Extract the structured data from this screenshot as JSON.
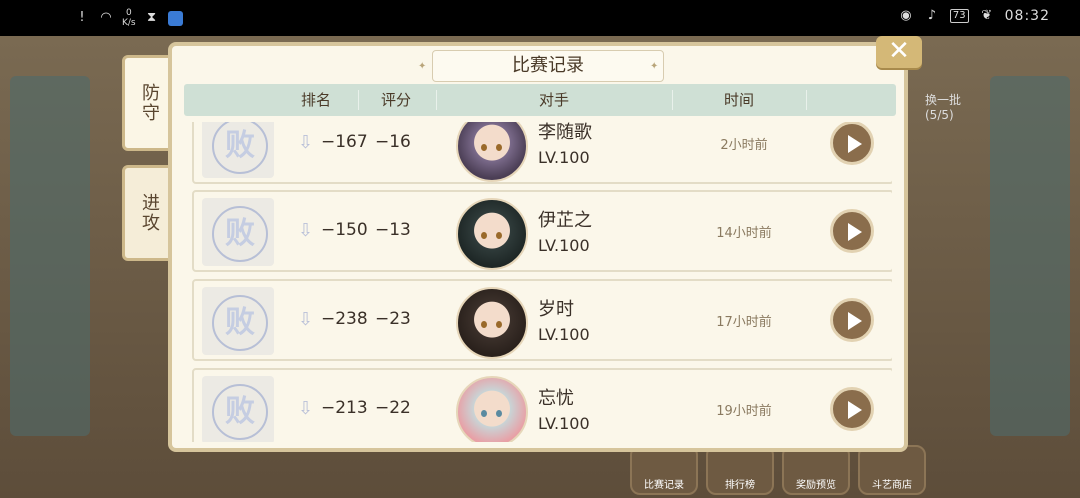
{
  "statusbar": {
    "net_speed_value": "0",
    "net_speed_unit": "K/s",
    "battery": "73",
    "time": "08:32"
  },
  "panel": {
    "title": "比赛记录",
    "headers": [
      "排名",
      "评分",
      "对手",
      "时间"
    ],
    "close_label": "✕"
  },
  "side_tabs": [
    {
      "label": "防守"
    },
    {
      "label": "进攻"
    }
  ],
  "records": [
    {
      "result": "败",
      "rank_change": "−167",
      "score_change": "−16",
      "opponent": "李随歌",
      "level": "LV.100",
      "time": "2小时前"
    },
    {
      "result": "败",
      "rank_change": "−150",
      "score_change": "−13",
      "opponent": "伊芷之",
      "level": "LV.100",
      "time": "14小时前"
    },
    {
      "result": "败",
      "rank_change": "−238",
      "score_change": "−23",
      "opponent": "岁时",
      "level": "LV.100",
      "time": "17小时前"
    },
    {
      "result": "败",
      "rank_change": "−213",
      "score_change": "−22",
      "opponent": "忘忧",
      "level": "LV.100",
      "time": "19小时前"
    }
  ],
  "background": {
    "top_right_label": "换一批",
    "top_right_count": "(5/5)",
    "bottom_buttons": [
      "比赛记录",
      "排行榜",
      "奖励预览",
      "斗艺商店"
    ]
  }
}
